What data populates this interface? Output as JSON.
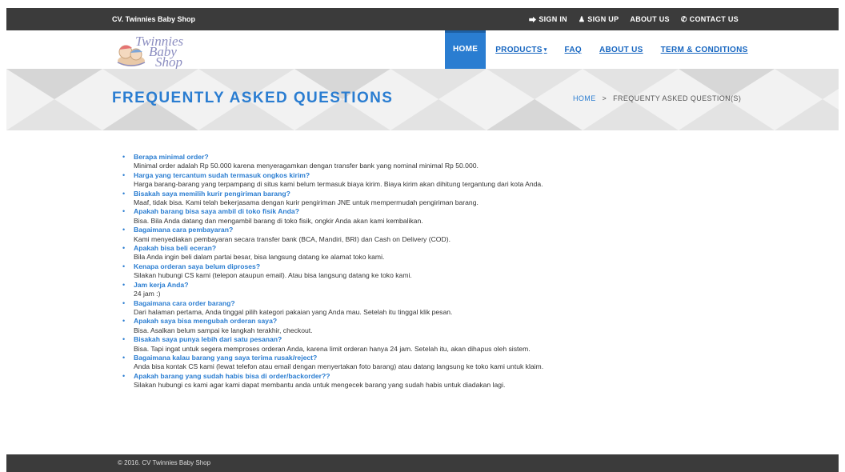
{
  "topbar": {
    "brand": "CV. Twinnies Baby Shop",
    "links": [
      {
        "icon": "sign-in-icon",
        "glyph": "⮕",
        "label": "SIGN IN"
      },
      {
        "icon": "user-icon",
        "glyph": "♟",
        "label": "SIGN UP"
      },
      {
        "icon": "",
        "glyph": "",
        "label": "ABOUT US"
      },
      {
        "icon": "phone-icon",
        "glyph": "✆",
        "label": "CONTACT US"
      }
    ]
  },
  "logo": {
    "line1": "Twinnies",
    "line2": "Baby",
    "line3": "Shop"
  },
  "nav": {
    "home": "HOME",
    "products": "PRODUCTS",
    "faq": "FAQ",
    "about": "ABOUT US",
    "terms": "TERM & CONDITIONS"
  },
  "banner": {
    "title": "FREQUENTLY ASKED QUESTIONS",
    "crumb_home": "HOME",
    "crumb_sep": ">",
    "crumb_current": "FREQUENTY ASKED QUESTION(S)"
  },
  "faq": [
    {
      "q": "Berapa minimal order?",
      "a": "Minimal order adalah Rp 50.000 karena menyeragamkan dengan transfer bank yang nominal minimal Rp 50.000."
    },
    {
      "q": "Harga yang tercantum sudah termasuk ongkos kirim?",
      "a": "Harga barang-barang yang terpampang di situs kami belum termasuk biaya kirim. Biaya kirim akan dihitung tergantung dari kota Anda."
    },
    {
      "q": "Bisakah saya memilih kurir pengiriman barang?",
      "a": "Maaf, tidak bisa. Kami telah bekerjasama dengan kurir pengiriman JNE untuk mempermudah pengiriman barang."
    },
    {
      "q": "Apakah barang bisa saya ambil di toko fisik Anda?",
      "a": "Bisa. Bila Anda datang dan mengambil barang di toko fisik, ongkir Anda akan kami kembalikan."
    },
    {
      "q": "Bagaimana cara pembayaran?",
      "a": "Kami menyediakan pembayaran secara transfer bank (BCA, Mandiri, BRI) dan Cash on Delivery (COD)."
    },
    {
      "q": "Apakah bisa beli eceran?",
      "a": "Bila Anda ingin beli dalam partai besar, bisa langsung datang ke alamat toko kami."
    },
    {
      "q": "Kenapa orderan saya belum diproses?",
      "a": "Silakan hubungi CS kami (telepon ataupun email). Atau bisa langsung datang ke toko kami."
    },
    {
      "q": "Jam kerja Anda?",
      "a": "24 jam :)"
    },
    {
      "q": "Bagaimana cara order barang?",
      "a": "Dari halaman pertama, Anda tinggal pilih kategori pakaian yang Anda mau. Setelah itu tinggal klik pesan."
    },
    {
      "q": "Apakah saya bisa mengubah orderan saya?",
      "a": "Bisa. Asalkan belum sampai ke langkah terakhir, checkout."
    },
    {
      "q": "Bisakah saya punya lebih dari satu pesanan?",
      "a": "Bisa. Tapi ingat untuk segera memproses orderan Anda, karena limit orderan hanya 24 jam. Setelah itu, akan dihapus oleh sistem."
    },
    {
      "q": "Bagaimana kalau barang yang saya terima rusak/reject?",
      "a": "Anda bisa kontak CS kami (lewat telefon atau email dengan menyertakan foto barang) atau datang langsung ke toko kami untuk klaim."
    },
    {
      "q": "Apakah barang yang sudah habis bisa di order/backorder??",
      "a": "Silakan hubungi cs kami agar kami dapat membantu anda untuk mengecek barang yang sudah habis untuk diadakan lagi."
    }
  ],
  "footer": {
    "copyright": "© 2016. CV Twinnies Baby Shop"
  },
  "colors": {
    "accent": "#2a7dd1",
    "dark_bar": "#3b3b3b",
    "banner_bg": "#e3e3e3"
  }
}
